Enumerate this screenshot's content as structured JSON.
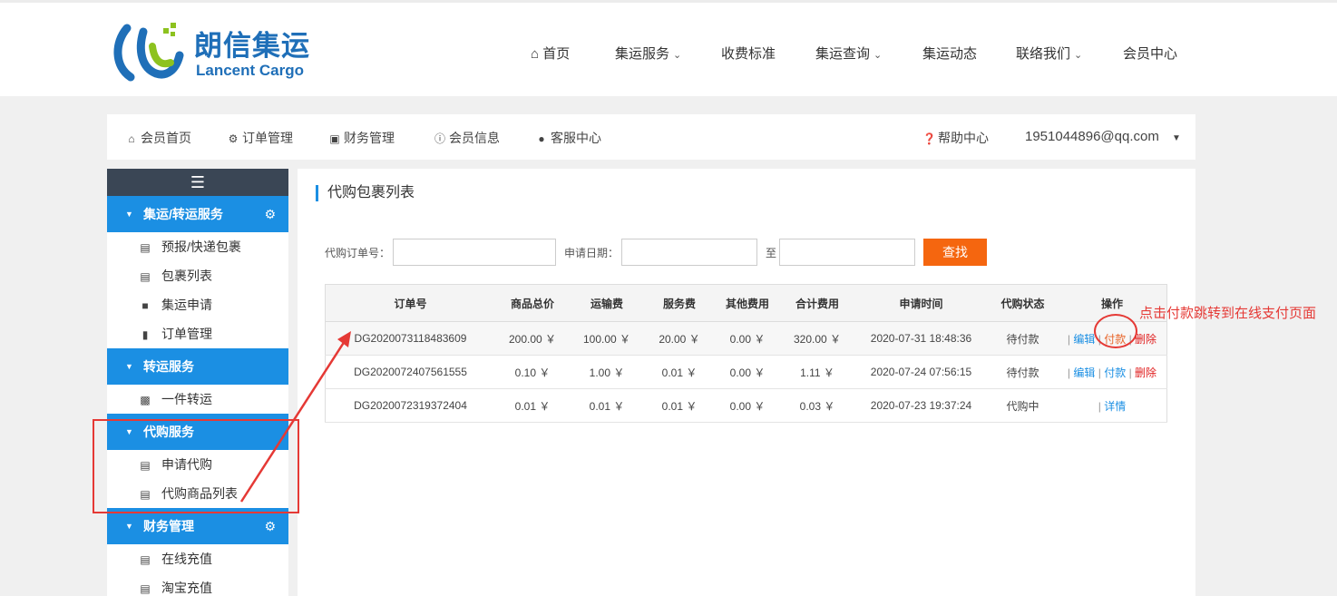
{
  "header": {
    "logo_cn": "朗信集运",
    "logo_en": "Lancent Cargo",
    "nav": [
      {
        "label": "首页",
        "icon": "home-icon",
        "dropdown": false
      },
      {
        "label": "集运服务",
        "dropdown": true
      },
      {
        "label": "收费标准",
        "dropdown": false
      },
      {
        "label": "集运查询",
        "dropdown": true
      },
      {
        "label": "集运动态",
        "dropdown": false
      },
      {
        "label": "联络我们",
        "dropdown": true
      },
      {
        "label": "会员中心",
        "dropdown": false
      }
    ]
  },
  "memberbar": {
    "items": [
      {
        "label": "会员首页",
        "icon": "home-icon"
      },
      {
        "label": "订单管理",
        "icon": "gear-icon"
      },
      {
        "label": "财务管理",
        "icon": "money-icon"
      },
      {
        "label": "会员信息",
        "icon": "info-icon"
      },
      {
        "label": "客服中心",
        "icon": "user-icon"
      }
    ],
    "help": "帮助中心",
    "user": "1951044896@qq.com"
  },
  "sidebar": {
    "toggle_icon": "menu-icon",
    "sections": [
      {
        "title": "集运/转运服务",
        "gear": true,
        "items": [
          {
            "label": "预报/快递包裹",
            "icon": "inbox-icon"
          },
          {
            "label": "包裹列表",
            "icon": "list-icon"
          },
          {
            "label": "集运申请",
            "icon": "truck-icon"
          },
          {
            "label": "订单管理",
            "icon": "book-icon"
          }
        ]
      },
      {
        "title": "转运服务",
        "gear": false,
        "items": [
          {
            "label": "一件转运",
            "icon": "bar-chart-icon"
          }
        ]
      },
      {
        "title": "代购服务",
        "gear": false,
        "items": [
          {
            "label": "申请代购",
            "icon": "inbox-icon"
          },
          {
            "label": "代购商品列表",
            "icon": "list-icon"
          }
        ]
      },
      {
        "title": "财务管理",
        "gear": true,
        "items": [
          {
            "label": "在线充值",
            "icon": "server-icon"
          },
          {
            "label": "淘宝充值",
            "icon": "card-icon"
          }
        ]
      }
    ]
  },
  "content": {
    "title": "代购包裹列表",
    "search": {
      "order_label": "代购订单号：",
      "date_label": "申请日期：",
      "to_label": "至",
      "button": "查找"
    },
    "table": {
      "headers": [
        "订单号",
        "商品总价",
        "运输费",
        "服务费",
        "其他费用",
        "合计费用",
        "申请时间",
        "代购状态",
        "操作"
      ],
      "rows": [
        {
          "order": "DG2020073118483609",
          "goods": "200.00 ￥",
          "shipping": "100.00 ￥",
          "service": "20.00 ￥",
          "other": "0.00 ￥",
          "total": "320.00 ￥",
          "time": "2020-07-31 18:48:36",
          "status": "待付款"
        },
        {
          "order": "DG2020072407561555",
          "goods": "0.10 ￥",
          "shipping": "1.00 ￥",
          "service": "0.01 ￥",
          "other": "0.00 ￥",
          "total": "1.11 ￥",
          "time": "2020-07-24 07:56:15",
          "status": "待付款"
        },
        {
          "order": "DG2020072319372404",
          "goods": "0.01 ￥",
          "shipping": "0.01 ￥",
          "service": "0.01 ￥",
          "other": "0.00 ￥",
          "total": "0.03 ￥",
          "time": "2020-07-23 19:37:24",
          "status": "代购中"
        }
      ],
      "ops": {
        "sep": "|",
        "edit": "编辑",
        "pay": "付款",
        "delete": "删除",
        "detail": "详情"
      }
    }
  },
  "annotation": {
    "text": "点击付款跳转到在线支付页面",
    "color": "#e53935"
  },
  "colors": {
    "primary": "#1b8fe3",
    "button": "#f5660f",
    "dark": "#3a4655"
  }
}
